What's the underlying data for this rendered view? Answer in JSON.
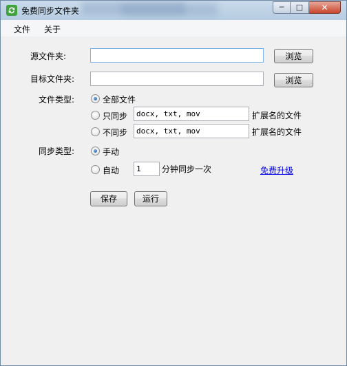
{
  "window": {
    "title": "免费同步文件夹",
    "controls": {
      "minimize": "─",
      "maximize": "□",
      "close": "✕"
    }
  },
  "menu": {
    "items": [
      "文件",
      "关于"
    ]
  },
  "form": {
    "source_label": "源文件夹:",
    "source_value": "",
    "target_label": "目标文件夹:",
    "target_value": "",
    "browse_label": "浏览",
    "filetype_label": "文件类型:",
    "filetype_options": {
      "all": "全部文件",
      "only": "只同步",
      "except": "不同步"
    },
    "only_ext_value": "docx, txt, mov",
    "except_ext_value": "docx, txt, mov",
    "ext_suffix": "扩展名的文件",
    "filetype_selected": "all",
    "sync_label": "同步类型:",
    "sync_options": {
      "manual": "手动",
      "auto": "自动"
    },
    "sync_selected": "manual",
    "interval_value": "1",
    "interval_suffix": "分钟同步一次",
    "upgrade_link": "免费升级",
    "save_label": "保存",
    "run_label": "运行"
  },
  "colors": {
    "titlebar": "#c9daea",
    "link": "#0000ee",
    "close_button": "#c8452c"
  },
  "icons": [
    "sync-arrows-icon"
  ]
}
